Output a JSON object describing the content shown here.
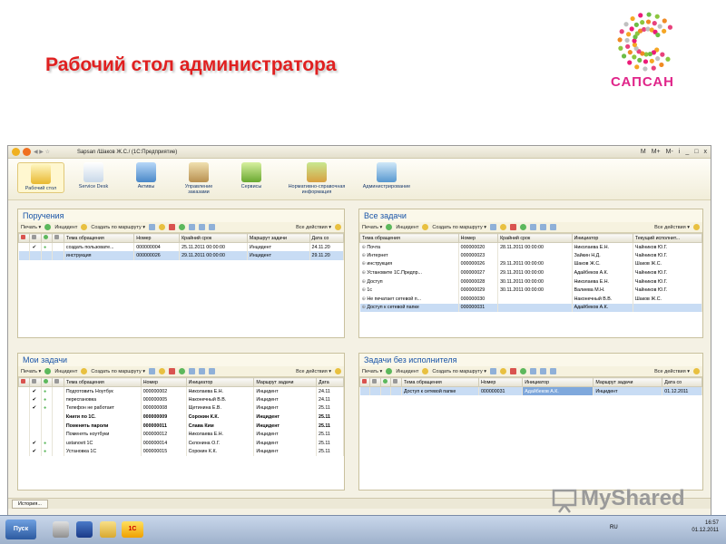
{
  "slide": {
    "title": "Рабочий стол администратора"
  },
  "logo": {
    "brand": "САПСАН"
  },
  "window": {
    "title": "Sapsan /Шаков Ж.С./ (1С:Предприятие)",
    "controls": [
      "M",
      "M+",
      "M-",
      "i",
      "_",
      "□",
      "x"
    ]
  },
  "sections": [
    {
      "label": "Рабочий стол",
      "icon": "desktop-icon"
    },
    {
      "label": "Service Desk",
      "icon": "clipboard-icon"
    },
    {
      "label": "Активы",
      "icon": "assets-icon"
    },
    {
      "label": "Управление заказами",
      "icon": "orders-icon"
    },
    {
      "label": "Сервисы",
      "icon": "gift-icon"
    },
    {
      "label": "Нормативно-справочная информация",
      "icon": "books-icon"
    },
    {
      "label": "Администрирование",
      "icon": "computer-icon"
    }
  ],
  "toolbar": {
    "print": "Печать ▾",
    "incident": "Инцидент",
    "route": "Создать по маршруту ▾",
    "actions": "Все действия ▾"
  },
  "panels": {
    "assignments": {
      "title": "Поручения",
      "columns": [
        "",
        "",
        "",
        "",
        "Тема обращения",
        "Номер",
        "Крайний срок",
        "Маршрут задачи",
        "Дата со"
      ],
      "rows": [
        [
          "",
          "✔",
          "●",
          "",
          "создать пользовате...",
          "000000004",
          "25.11.2011 00:00:00",
          "Инцидент",
          "24.11.20"
        ],
        [
          "",
          "",
          "",
          "",
          "инструкция",
          "000000026",
          "29.11.2011 00:00:00",
          "Инцидент",
          "29.11.20"
        ]
      ]
    },
    "all_tasks": {
      "title": "Все задачи",
      "columns": [
        "Тема обращения",
        "Номер",
        "Крайний срок",
        "Инициатор",
        "Текущий исполнит..."
      ],
      "rows": [
        [
          "Почта",
          "000000020",
          "28.11.2011 00:00:00",
          "Николаева Е.Н.",
          "Чайников Ю.Г."
        ],
        [
          "Интернет",
          "000000023",
          "",
          "Зайкин Н.Д.",
          "Чайников Ю.Г."
        ],
        [
          "инструкция",
          "000000026",
          "29.11.2011 00:00:00",
          "Шаков Ж.С.",
          "Шаков Ж.С."
        ],
        [
          "Установите 1С.Предпр...",
          "000000027",
          "29.11.2011 00:00:00",
          "Адайбеков А.К.",
          "Чайников Ю.Г."
        ],
        [
          "Доступ",
          "000000028",
          "30.11.2011 00:00:00",
          "Николаева Е.Н.",
          "Чайников Ю.Г."
        ],
        [
          "1с",
          "000000029",
          "30.11.2011 00:00:00",
          "Валиева М.Н.",
          "Чайников Ю.Г."
        ],
        [
          "Не печатает сетевой п...",
          "000000030",
          "",
          "Наконечный В.В.",
          "Шаков Ж.С."
        ],
        [
          "Доступ к сетевой папке",
          "000000031",
          "",
          "Адайбеков А.К.",
          ""
        ]
      ]
    },
    "my_tasks": {
      "title": "Мои задачи",
      "columns": [
        "",
        "",
        "",
        "",
        "Тема обращения",
        "Номер",
        "Инициатор",
        "Маршрут задачи",
        "Дата"
      ],
      "rows": [
        [
          "",
          "✔",
          "●",
          "",
          "Подготовить Ноутбук",
          "000000002",
          "Николаева Е.Н.",
          "Инцидент",
          "24.11"
        ],
        [
          "",
          "✔",
          "●",
          "",
          "пересгановка",
          "000000005",
          "Наконечный В.В.",
          "Инцидент",
          "24.11"
        ],
        [
          "",
          "✔",
          "●",
          "",
          "Телефон не работает",
          "000000008",
          "Щетинина Е.В.",
          "Инцидент",
          "25.11"
        ],
        [
          "",
          "",
          "",
          "",
          "Книги по 1С.",
          "000000009",
          "Сорокин К.К.",
          "Инцидент",
          "25.11"
        ],
        [
          "",
          "",
          "",
          "",
          "Поменять пароли",
          "000000011",
          "Слава Ким",
          "Инцидент",
          "25.11"
        ],
        [
          "",
          "",
          "",
          "",
          "Поменять ноутбуки",
          "000000012",
          "Николаева Е.Н.",
          "Инцидент",
          "25.11"
        ],
        [
          "",
          "✔",
          "●",
          "",
          "ustanovit 1C",
          "000000014",
          "Склонина О.Г.",
          "Инцидент",
          "25.11"
        ],
        [
          "",
          "✔",
          "●",
          "",
          "Установка 1С",
          "000000015",
          "Сорокин К.К.",
          "Инцидент",
          "25.11"
        ]
      ]
    },
    "unassigned": {
      "title": "Задачи без исполнителя",
      "columns": [
        "",
        "",
        "",
        "",
        "Тема обращения",
        "Номер",
        "Инициатор",
        "Маршрут задачи",
        "Дата со"
      ],
      "rows": [
        [
          "",
          "",
          "",
          "",
          "Доступ к сетевой папке",
          "000000031",
          "Адайбеков А.К.",
          "Инцидент",
          "01.12.2011"
        ]
      ]
    }
  },
  "history_button": "История...",
  "taskbar": {
    "start": "Пуск",
    "lang": "RU",
    "time": "16:57",
    "date": "01.12.2011"
  },
  "watermark": "MyShared",
  "colors": {
    "title_red": "#e02020",
    "panel_title_blue": "#1a55a8",
    "selection": "#c8dcf4"
  }
}
